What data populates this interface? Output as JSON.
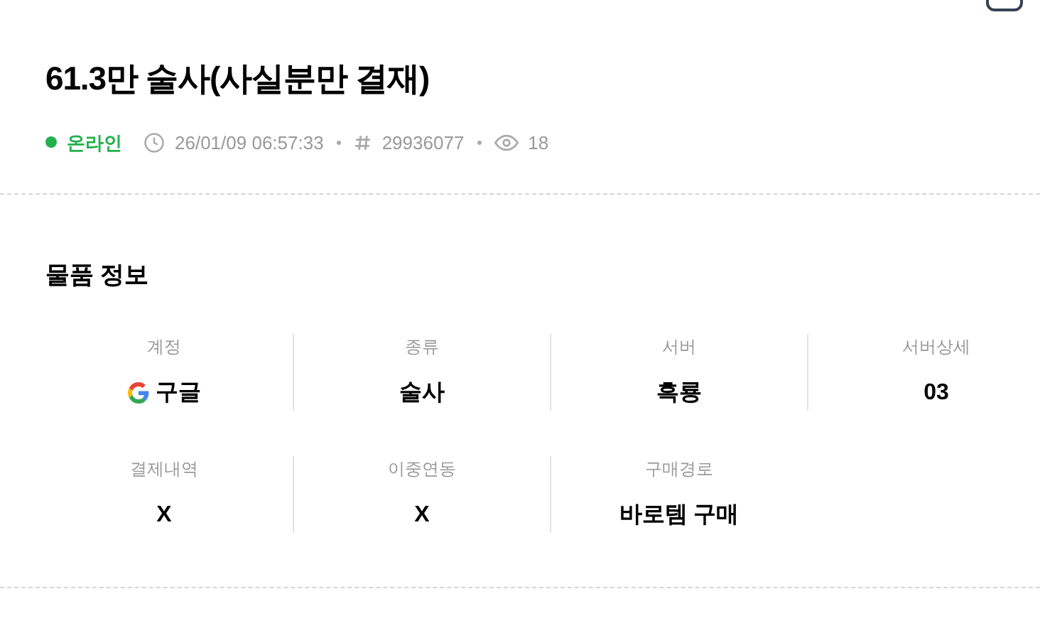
{
  "title": "61.3만 술사(사실분만 결재)",
  "meta": {
    "status": {
      "label": "온라인",
      "online": true
    },
    "datetime": "26/01/09 06:57:33",
    "number": "29936077",
    "views": "18"
  },
  "section": {
    "title": "물품 정보",
    "fields": [
      {
        "label": "계정",
        "value": "구글",
        "kind": "google"
      },
      {
        "label": "종류",
        "value": "술사",
        "kind": "text"
      },
      {
        "label": "서버",
        "value": "흑룡",
        "kind": "text"
      },
      {
        "label": "서버상세",
        "value": "03",
        "kind": "text"
      },
      {
        "label": "결제내역",
        "value": "X",
        "kind": "text"
      },
      {
        "label": "이중연동",
        "value": "X",
        "kind": "text"
      },
      {
        "label": "구매경로",
        "value": "바로템 구매",
        "kind": "text"
      }
    ]
  }
}
